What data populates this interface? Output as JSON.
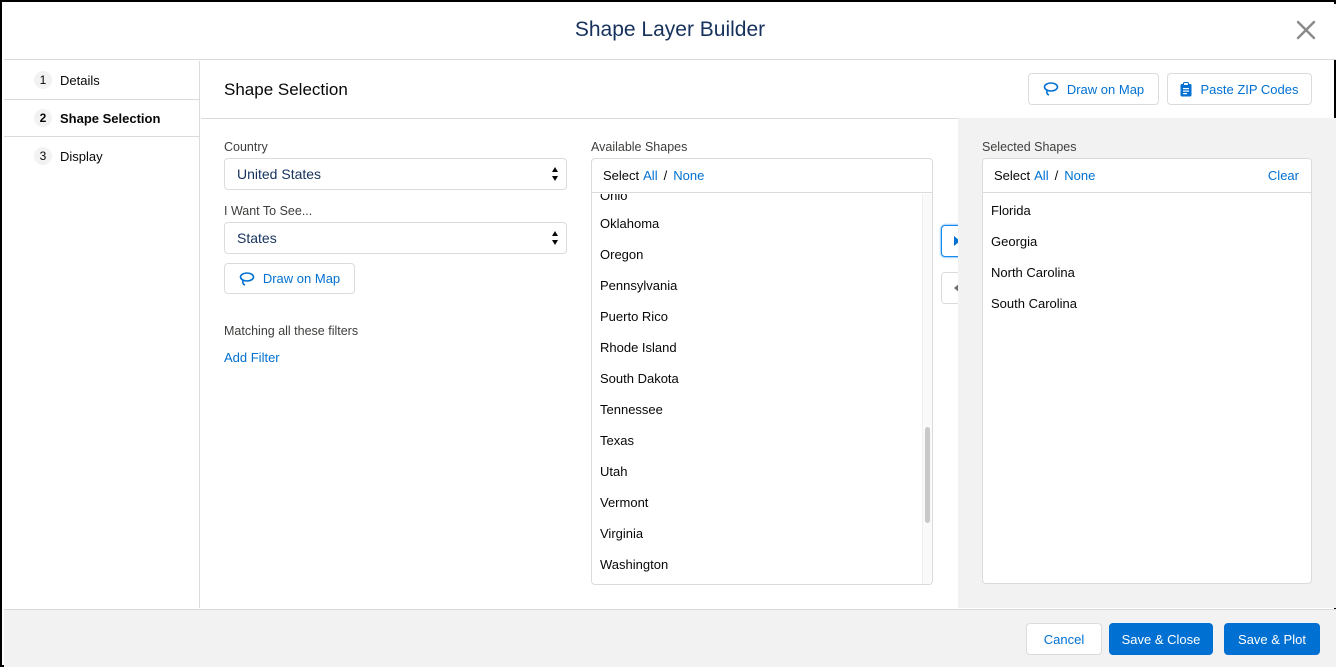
{
  "modal": {
    "title": "Shape Layer Builder"
  },
  "steps": [
    {
      "num": "1",
      "label": "Details"
    },
    {
      "num": "2",
      "label": "Shape Selection"
    },
    {
      "num": "3",
      "label": "Display"
    }
  ],
  "section": {
    "title": "Shape Selection",
    "draw_on_map_label": "Draw on Map",
    "paste_zip_label": "Paste ZIP Codes"
  },
  "filters": {
    "country_label": "Country",
    "country_value": "United States",
    "see_label": "I Want To See...",
    "see_value": "States",
    "draw_on_map_label": "Draw on Map",
    "matching_label": "Matching all these filters",
    "add_filter_label": "Add Filter"
  },
  "available": {
    "label": "Available Shapes",
    "select_prefix": "Select",
    "all_label": "All",
    "separator": "/",
    "none_label": "None",
    "partial_item": "Ohio",
    "items": [
      "Oklahoma",
      "Oregon",
      "Pennsylvania",
      "Puerto Rico",
      "Rhode Island",
      "South Dakota",
      "Tennessee",
      "Texas",
      "Utah",
      "Vermont",
      "Virginia",
      "Washington"
    ]
  },
  "selected": {
    "label": "Selected Shapes",
    "select_prefix": "Select",
    "all_label": "All",
    "separator": "/",
    "none_label": "None",
    "clear_label": "Clear",
    "items": [
      "Florida",
      "Georgia",
      "North Carolina",
      "South Carolina"
    ]
  },
  "footer": {
    "cancel_label": "Cancel",
    "save_close_label": "Save & Close",
    "save_plot_label": "Save & Plot"
  },
  "colors": {
    "brand": "#0070d2",
    "title": "#16325c",
    "border": "#dddbda",
    "panel_bg": "#f3f2f2"
  },
  "icons": {
    "close": "close-icon",
    "lasso": "lasso-icon",
    "clipboard": "clipboard-icon",
    "move_right": "caret-right-icon",
    "move_left": "caret-left-icon"
  }
}
